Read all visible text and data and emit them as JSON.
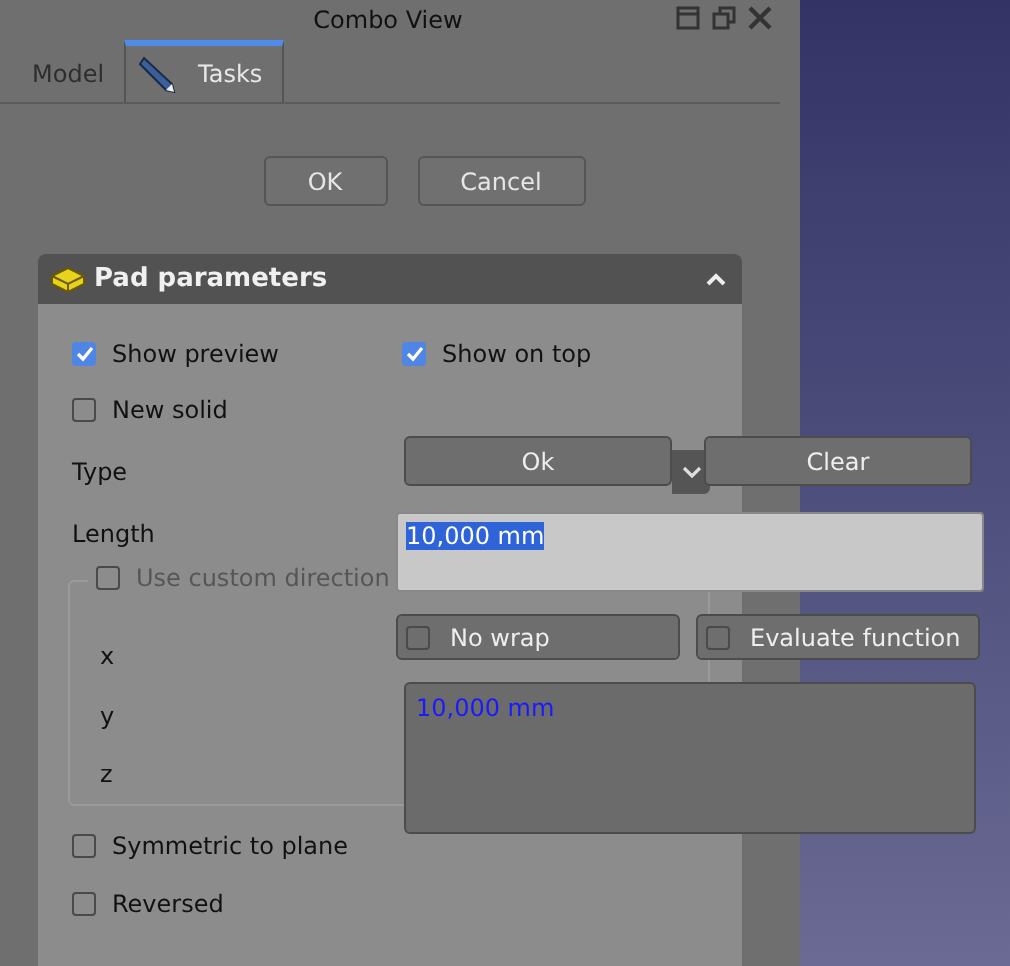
{
  "window": {
    "title": "Combo View"
  },
  "tabs": [
    {
      "label": "Model",
      "selected": false
    },
    {
      "label": "Tasks",
      "selected": true
    }
  ],
  "dialog_buttons": [
    "OK",
    "Cancel"
  ],
  "section": {
    "title": "Pad parameters",
    "expanded": true
  },
  "options": [
    {
      "label": "Show preview",
      "checked": true
    },
    {
      "label": "Show on top",
      "checked": true
    },
    {
      "label": "New solid",
      "checked": false
    }
  ],
  "fields": [
    {
      "label": "Type"
    },
    {
      "label": "Length"
    }
  ],
  "custom_direction": {
    "label": "Use custom direction",
    "checked": false,
    "disabled": true,
    "axes": [
      "x",
      "y",
      "z"
    ]
  },
  "bottom_options": [
    {
      "label": "Symmetric to plane",
      "checked": false
    },
    {
      "label": "Reversed",
      "checked": false
    }
  ],
  "expression_editor": {
    "buttons": [
      "Ok",
      "Clear"
    ],
    "value": "10,000 mm",
    "options": [
      {
        "label": "No wrap",
        "checked": false
      },
      {
        "label": "Evaluate function",
        "checked": false
      }
    ],
    "result": "10,000 mm"
  }
}
